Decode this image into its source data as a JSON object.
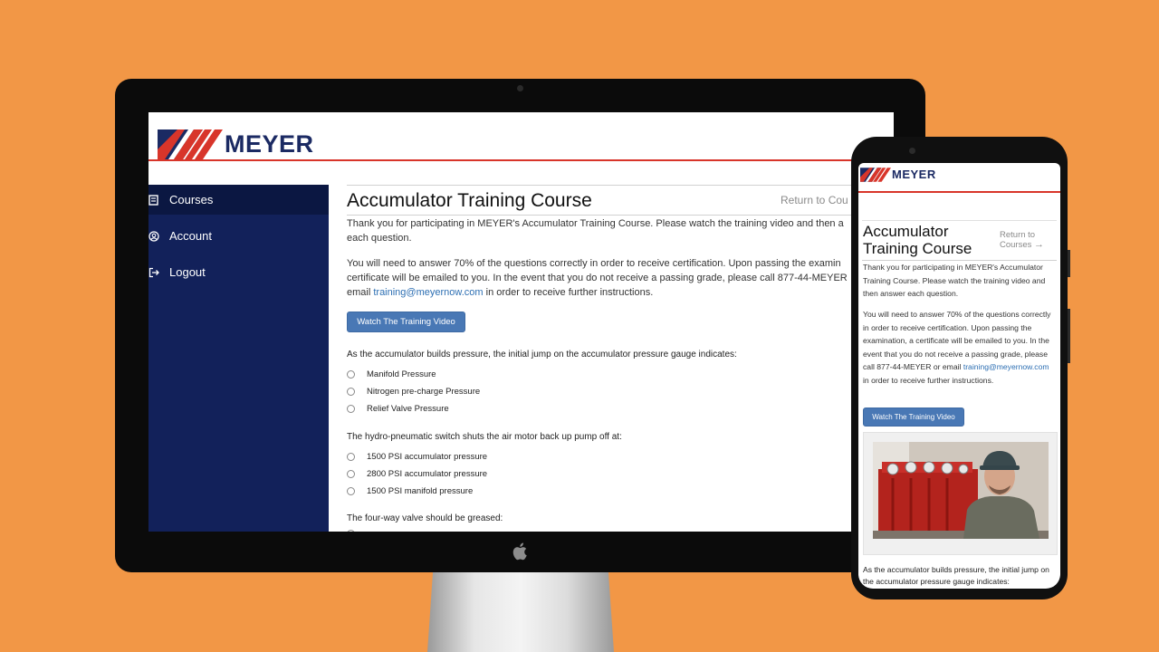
{
  "brand": {
    "name": "MEYER",
    "accent": "#d8352a",
    "navy": "#1b2a63"
  },
  "background_color": "#F29746",
  "desktop": {
    "nav": [
      {
        "label": "Courses",
        "icon": "book-icon",
        "active": true
      },
      {
        "label": "Account",
        "icon": "user-circle-icon",
        "active": false
      },
      {
        "label": "Logout",
        "icon": "logout-icon",
        "active": false
      }
    ],
    "title": "Accumulator Training Course",
    "return_label": "Return to Cou",
    "intro_line1": "Thank you for participating in MEYER's Accumulator Training Course. Please watch the training video and then a",
    "intro_line2": "each question.",
    "req_line1": "You will need to answer 70% of the questions correctly in order to receive certification. Upon passing the examin",
    "req_line2": "certificate will be emailed to you. In the event that you do not receive a passing grade, please call 877-44-MEYER",
    "req_line3_pre": "email ",
    "email": "training@meyernow.com",
    "req_line3_post": " in order to receive further instructions.",
    "watch_button": "Watch The Training Video",
    "questions": [
      {
        "text": "As the accumulator builds pressure, the initial jump on the accumulator pressure gauge indicates:",
        "options": [
          "Manifold Pressure",
          "Nitrogen pre-charge Pressure",
          "Relief Valve Pressure"
        ]
      },
      {
        "text": "The hydro-pneumatic switch shuts the air motor back up pump off at:",
        "options": [
          "1500 PSI accumulator pressure",
          "2800 PSI accumulator pressure",
          "1500 PSI manifold pressure"
        ]
      },
      {
        "text": "The four-way valve should be greased:",
        "options": []
      }
    ]
  },
  "mobile": {
    "title": "Accumulator Training Course",
    "return_label": "Return to Courses",
    "return_arrow": "→",
    "intro": "Thank you for participating in MEYER's Accumulator Training Course. Please watch the training video and then answer each question.",
    "req_pre": "You will need to answer 70% of the questions correctly in order to receive certification. Upon passing the examination, a certificate will be emailed to you. In the event that you do not receive a passing grade, please call 877-44-MEYER or email ",
    "email": "training@meyernow.com",
    "req_post": " in order to receive further instructions.",
    "watch_button": "Watch The Training Video",
    "video_thumbnail": "training-video-thumbnail",
    "question1": "As the accumulator builds pressure, the initial jump on the accumulator pressure gauge indicates:"
  }
}
